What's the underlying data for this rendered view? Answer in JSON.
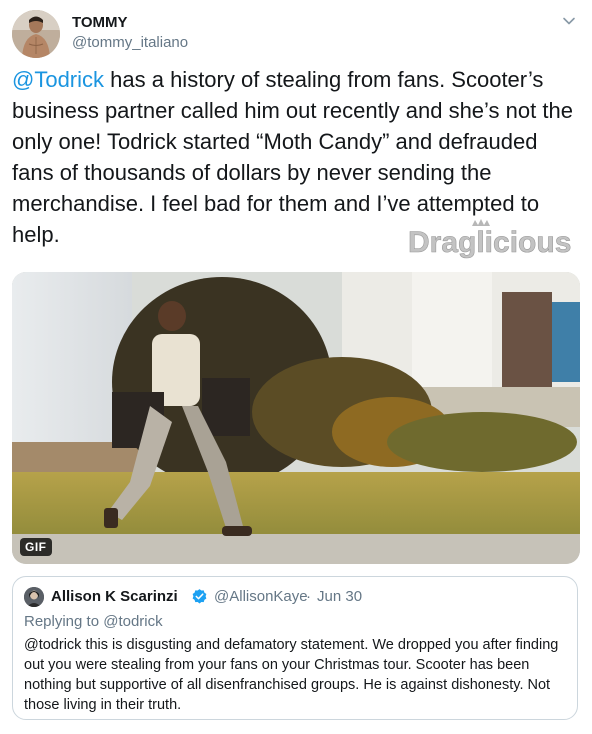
{
  "author": {
    "display_name": "TOMMY",
    "handle": "@tommy_italiano"
  },
  "tweet": {
    "mention": "@Todrick",
    "text": " has a history of stealing from fans. Scooter’s business partner called him out recently and she’s not the only one! Todrick started “Moth Candy” and defrauded fans of thousands of dollars by never sending the merchandise. I feel bad for them and I’ve attempted to help."
  },
  "watermark": {
    "text": "Draglicious"
  },
  "media": {
    "badge": "GIF"
  },
  "quoted_tweet": {
    "display_name": "Allison K Scarinzi",
    "verified": true,
    "handle": "@AllisonKaye",
    "separator": "·",
    "date": "Jun 30",
    "replying_prefix": "Replying to",
    "replying_handle": "@todrick",
    "text": "@todrick this is disgusting and defamatory statement. We dropped you after finding out you were stealing from your fans on your Christmas tour. Scooter has been nothing but supportive of all disenfranchised groups. He is against dishonesty. Not those living in their truth."
  },
  "icons": {
    "more": "chevron-down-icon",
    "verified": "verified-badge-icon",
    "crown": "crown-icon"
  },
  "colors": {
    "link": "#1b95e0",
    "muted": "#657786",
    "verified": "#1da1f2",
    "border": "#ccd6dd"
  }
}
